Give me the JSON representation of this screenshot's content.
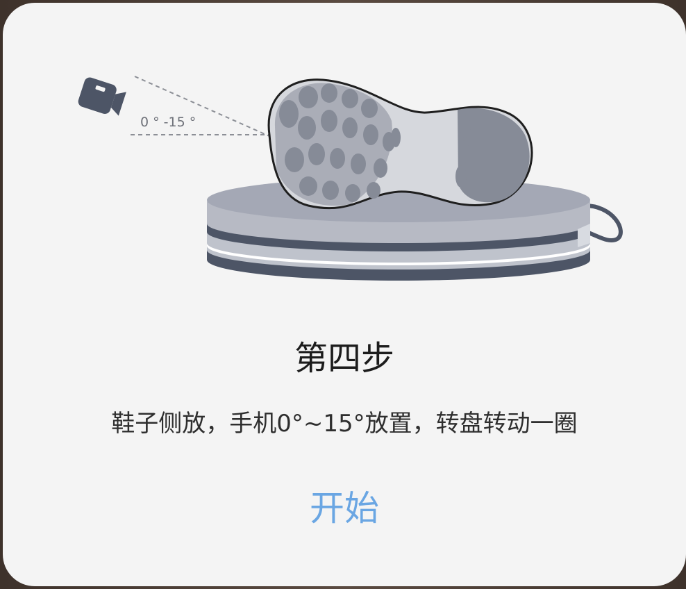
{
  "step": {
    "title": "第四步",
    "description": "鞋子侧放，手机0°~15°放置，转盘转动一圈",
    "angle_label": "0 ° -15 °"
  },
  "actions": {
    "start_label": "开始"
  },
  "colors": {
    "accent": "#6aa6e3",
    "dialog_bg": "#f4f4f4",
    "title_text": "#1c1c1c",
    "body_text": "#2e2e2e"
  },
  "icons": {
    "camera": "camera-icon",
    "shoe": "shoe-sole-illustration",
    "turntable": "turntable-illustration"
  }
}
